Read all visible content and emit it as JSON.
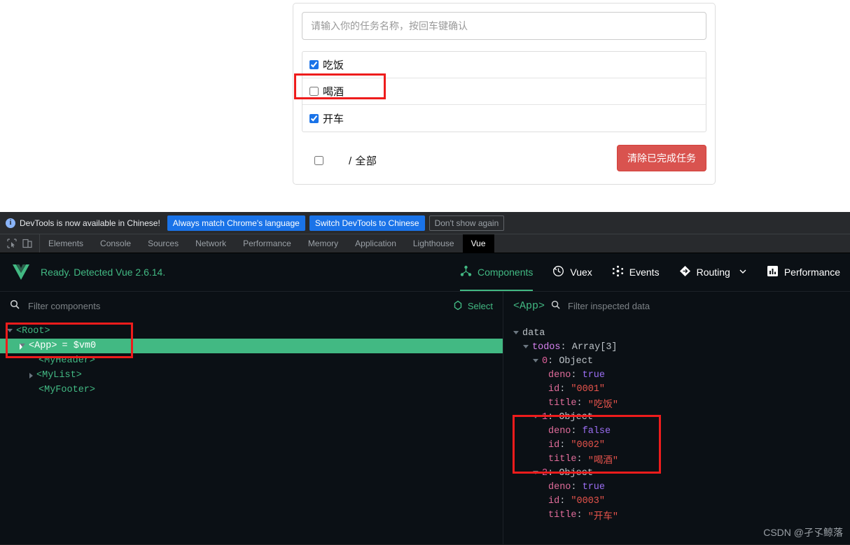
{
  "app": {
    "input_placeholder": "请输入你的任务名称，按回车键确认",
    "input_value": "",
    "todos": [
      {
        "label": "吃饭",
        "checked": true
      },
      {
        "label": "喝酒",
        "checked": false
      },
      {
        "label": "开车",
        "checked": true
      }
    ],
    "footer": {
      "select_all_checked": false,
      "count_text": "/ 全部",
      "clear_button": "清除已完成任务"
    }
  },
  "devtools": {
    "banner": {
      "info_icon": "info-icon",
      "message": "DevTools is now available in Chinese!",
      "btn_always_match": "Always match Chrome's language",
      "btn_switch": "Switch DevTools to Chinese",
      "btn_dismiss": "Don't show again"
    },
    "toolbar_icons": [
      "inspect-element-icon",
      "device-toolbar-icon"
    ],
    "tabs": [
      {
        "label": "Elements",
        "active": false
      },
      {
        "label": "Console",
        "active": false
      },
      {
        "label": "Sources",
        "active": false
      },
      {
        "label": "Network",
        "active": false
      },
      {
        "label": "Performance",
        "active": false
      },
      {
        "label": "Memory",
        "active": false
      },
      {
        "label": "Application",
        "active": false
      },
      {
        "label": "Lighthouse",
        "active": false
      },
      {
        "label": "Vue",
        "active": true
      }
    ]
  },
  "vue_panel": {
    "logo": "vue-logo-icon",
    "status": "Ready. Detected Vue 2.6.14.",
    "nav": [
      {
        "label": "Components",
        "icon": "components-icon",
        "active": true
      },
      {
        "label": "Vuex",
        "icon": "vuex-clock-icon",
        "active": false
      },
      {
        "label": "Events",
        "icon": "events-dots-icon",
        "active": false
      },
      {
        "label": "Routing",
        "icon": "routing-diamond-icon",
        "active": false,
        "chevron": true
      },
      {
        "label": "Performance",
        "icon": "performance-bars-icon",
        "active": false
      }
    ],
    "filter": {
      "search_icon": "search-icon",
      "placeholder": "Filter components",
      "value": "",
      "select_label": "Select",
      "select_icon": "target-icon"
    },
    "inspector": {
      "component_tag": "<App>",
      "search_icon": "search-icon",
      "placeholder": "Filter inspected data",
      "value": ""
    },
    "tree": [
      {
        "label": "<Root>",
        "indent": 0,
        "arrow": "down",
        "selected": false,
        "suffix": ""
      },
      {
        "label": "<App>",
        "indent": 1,
        "arrow": "down",
        "selected": true,
        "suffix": "= $vm0"
      },
      {
        "label": "<MyHeader>",
        "indent": 2,
        "arrow": "none",
        "selected": false,
        "suffix": ""
      },
      {
        "label": "<MyList>",
        "indent": 2,
        "arrow": "right",
        "selected": false,
        "suffix": ""
      },
      {
        "label": "<MyFooter>",
        "indent": 2,
        "arrow": "none",
        "selected": false,
        "suffix": ""
      }
    ],
    "data_tree": {
      "root_label": "data",
      "todos_label": "todos",
      "todos_type": "Array[3]",
      "items": [
        {
          "index": "0",
          "type": "Object",
          "deno_key": "deno",
          "deno_value": "true",
          "id_key": "id",
          "id_value": "\"0001\"",
          "title_key": "title",
          "title_value": "\"吃饭\""
        },
        {
          "index": "1",
          "type": "Object",
          "deno_key": "deno",
          "deno_value": "false",
          "id_key": "id",
          "id_value": "\"0002\"",
          "title_key": "title",
          "title_value": "\"喝酒\""
        },
        {
          "index": "2",
          "type": "Object",
          "deno_key": "deno",
          "deno_value": "true",
          "id_key": "id",
          "id_value": "\"0003\"",
          "title_key": "title",
          "title_value": "\"开车\""
        }
      ]
    }
  },
  "watermark": "CSDN @孑孓鲸落",
  "colors": {
    "vue_green": "#42b983",
    "devtools_bg": "#202124",
    "panel_bg": "#0b1015",
    "accent_blue": "#1a73e8",
    "danger_red": "#d9534f",
    "annotation_red": "#ee1c1c"
  }
}
